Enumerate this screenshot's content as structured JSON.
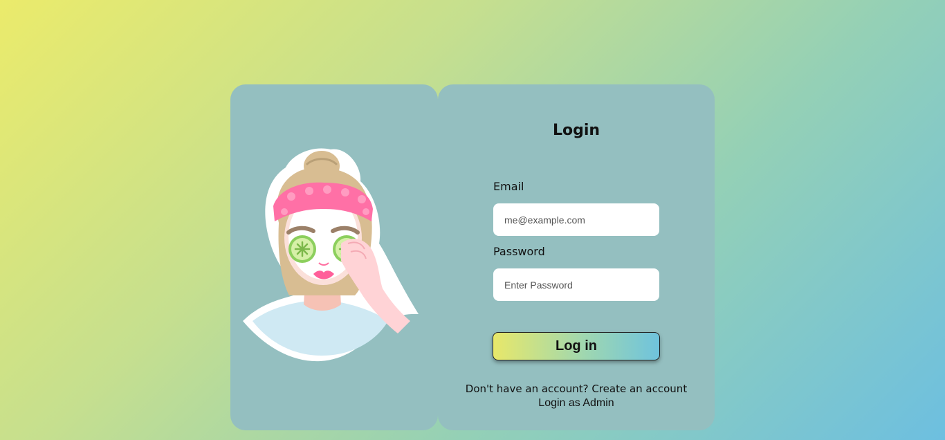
{
  "login": {
    "title": "Login",
    "email_label": "Email",
    "email_placeholder": "me@example.com",
    "password_label": "Password",
    "password_placeholder": "Enter Password",
    "submit_label": "Log in",
    "signup_prompt": "Don't have an account?",
    "signup_link": "Create an account",
    "admin_link": "Login as Admin"
  },
  "illustration": {
    "icon": "girl-face-mask-illustration"
  },
  "colors": {
    "panel": "#94bfc0",
    "gradient_start": "#ebeb6b",
    "gradient_end": "#6dbfe0"
  }
}
